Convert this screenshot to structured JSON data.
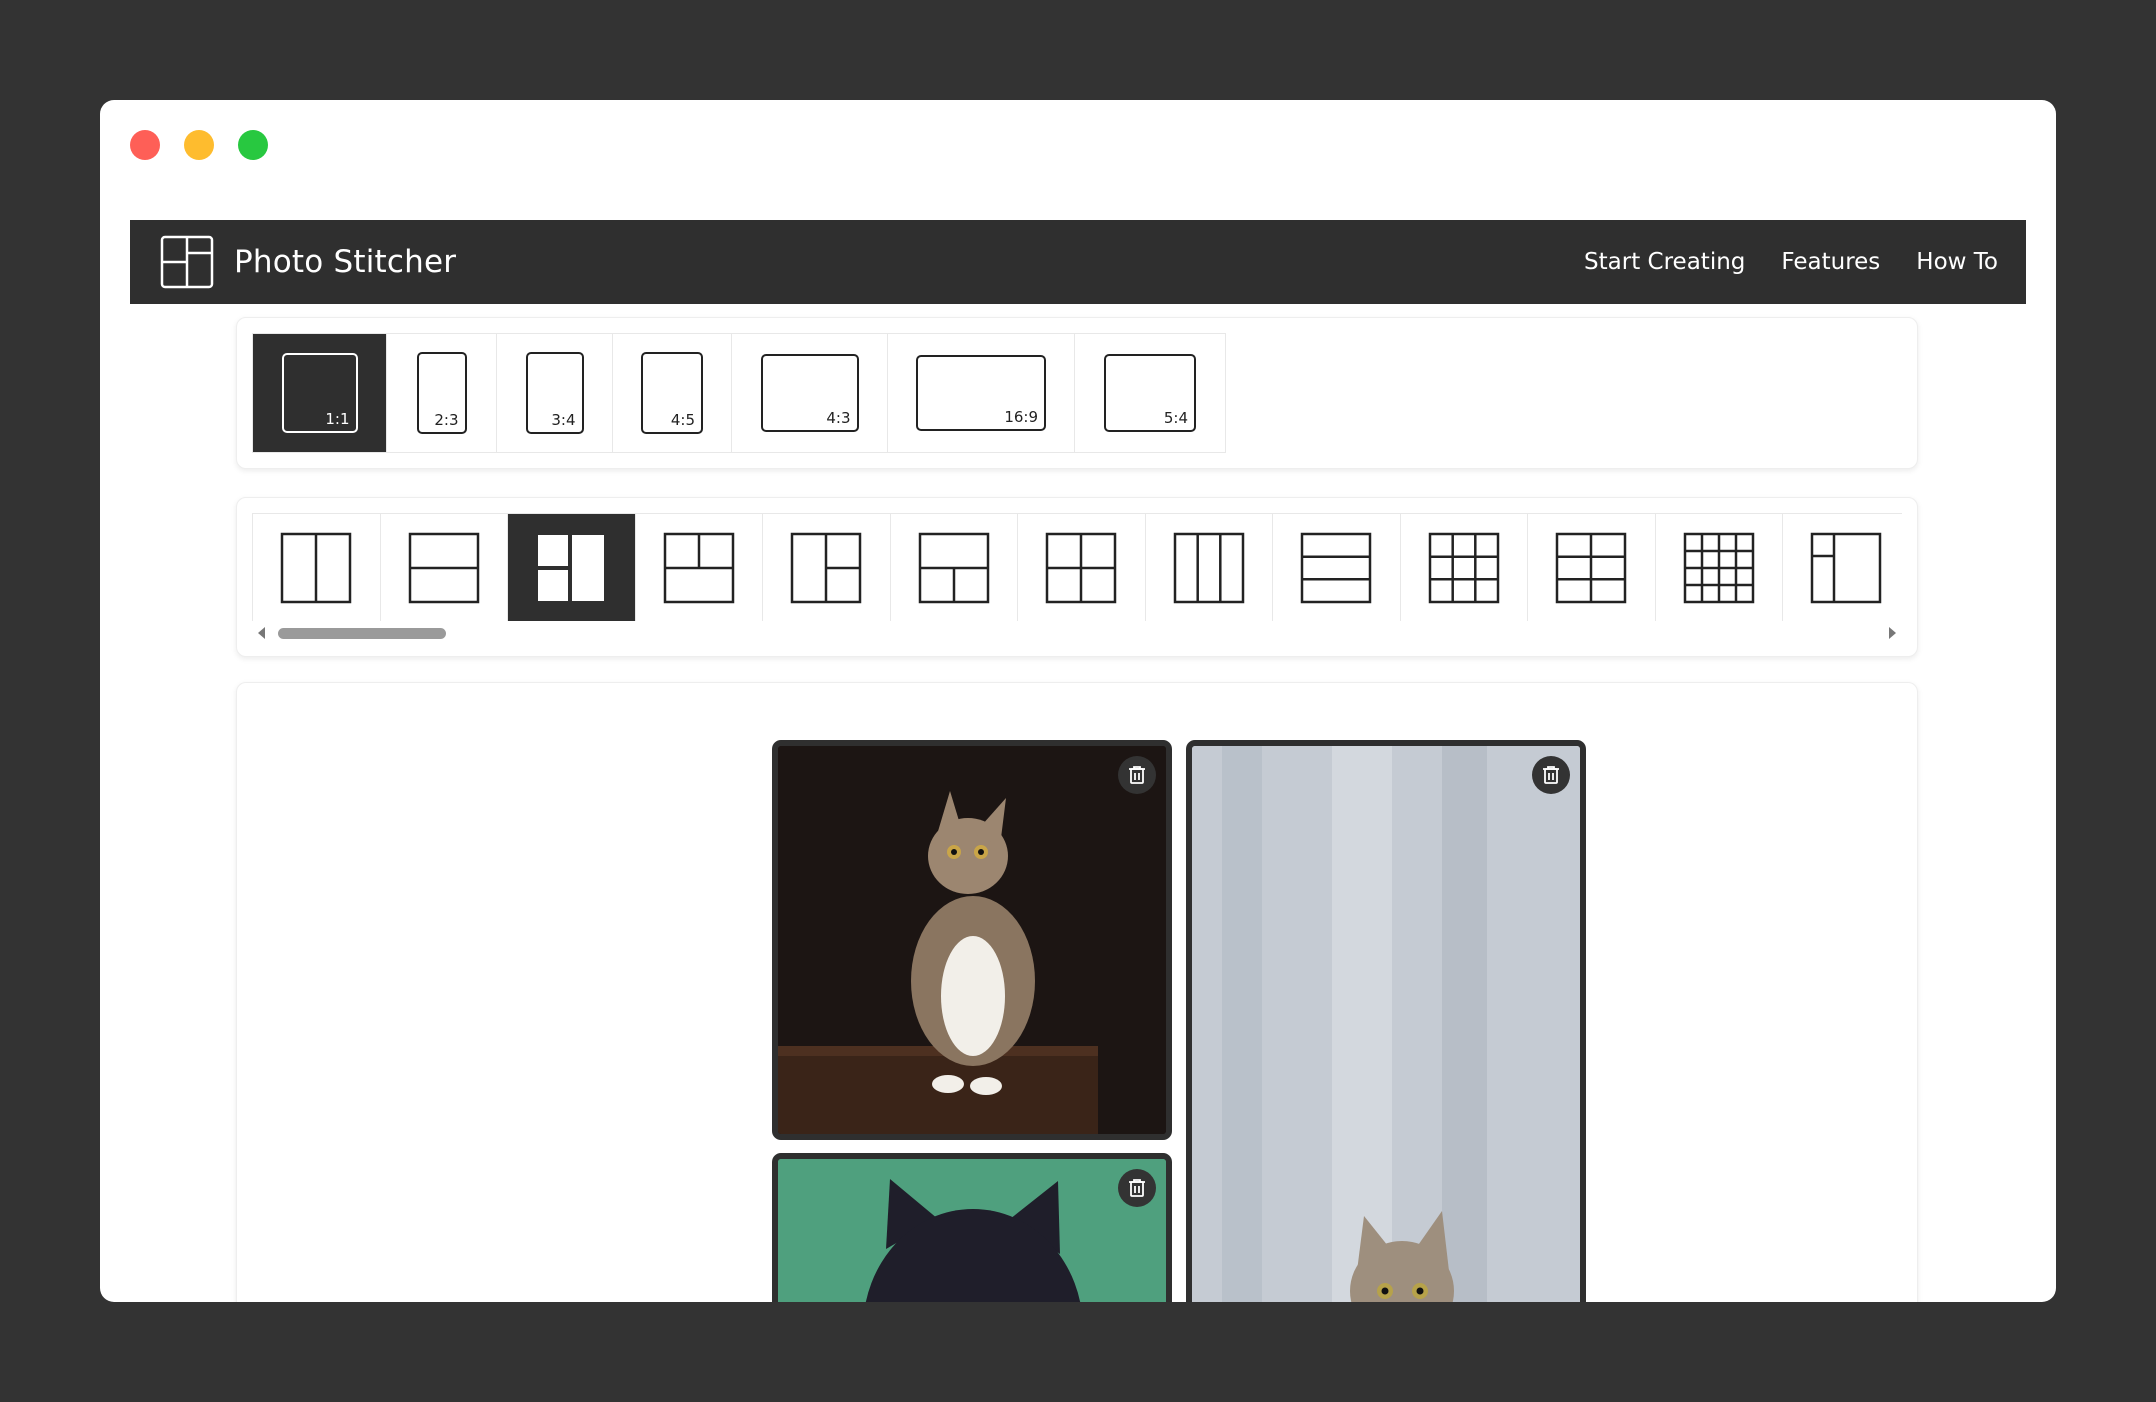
{
  "app": {
    "title": "Photo Stitcher",
    "accent": "#2f2f2f",
    "icon": "collage-layout-icon"
  },
  "nav": {
    "links": [
      {
        "label": "Start Creating"
      },
      {
        "label": "Features"
      },
      {
        "label": "How To"
      }
    ]
  },
  "aspect_ratios": {
    "selected": "1:1",
    "options": [
      {
        "label": "1:1"
      },
      {
        "label": "2:3"
      },
      {
        "label": "3:4"
      },
      {
        "label": "4:5"
      },
      {
        "label": "4:3"
      },
      {
        "label": "16:9"
      },
      {
        "label": "5:4"
      }
    ]
  },
  "layouts": {
    "selected_index": 2,
    "icons": [
      "two-columns-layout-icon",
      "two-rows-layout-icon",
      "left-stack-right-tall-layout-icon",
      "top-split-bottom-full-layout-icon",
      "left-tall-right-stack-layout-icon",
      "top-full-bottom-split-layout-icon",
      "two-by-two-grid-layout-icon",
      "three-columns-layout-icon",
      "three-rows-layout-icon",
      "three-by-three-grid-layout-icon",
      "three-by-two-grid-layout-icon",
      "four-by-four-grid-layout-icon",
      "sidebar-left-layout-icon"
    ]
  },
  "canvas": {
    "photos": [
      {
        "subject": "kitten-on-dark-background",
        "action_icon": "trash-icon"
      },
      {
        "subject": "kitten-on-grey-wall",
        "action_icon": "trash-icon"
      },
      {
        "subject": "black-cat-on-green-background",
        "action_icon": "trash-icon"
      }
    ]
  }
}
